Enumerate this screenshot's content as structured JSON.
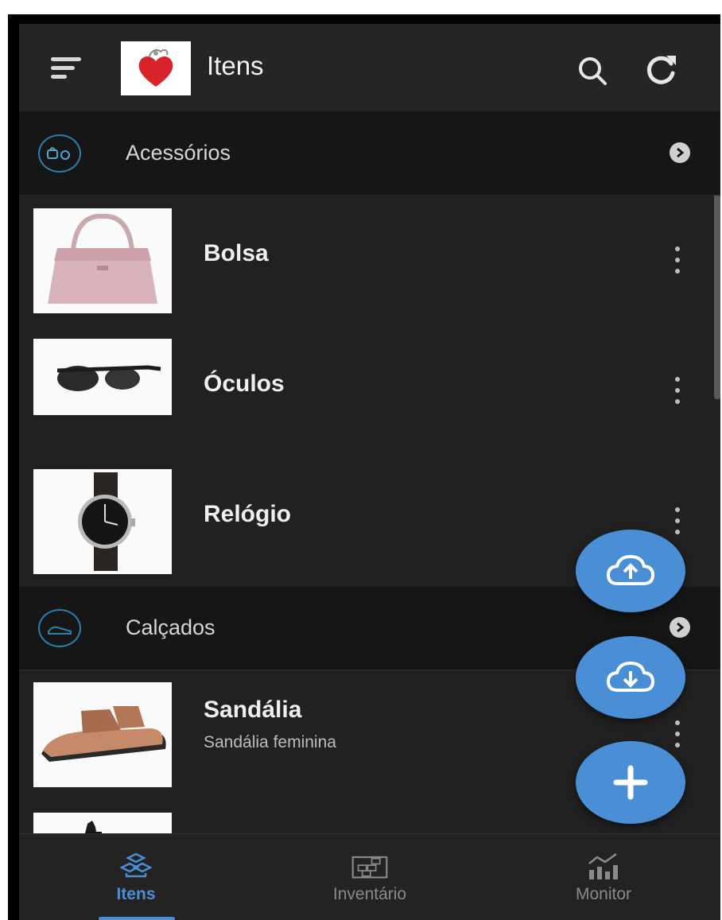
{
  "header": {
    "title": "Itens"
  },
  "categories": [
    {
      "label": "Acessórios",
      "items": [
        {
          "name": "Bolsa",
          "description": ""
        },
        {
          "name": "Óculos",
          "description": ""
        },
        {
          "name": "Relógio",
          "description": ""
        }
      ]
    },
    {
      "label": "Calçados",
      "items": [
        {
          "name": "Sandália",
          "description": "Sandália feminina"
        }
      ]
    }
  ],
  "bottom_nav": [
    {
      "label": "Itens",
      "active": true
    },
    {
      "label": "Inventário",
      "active": false
    },
    {
      "label": "Monitor",
      "active": false
    }
  ],
  "colors": {
    "accent": "#4a8fd6",
    "background": "#212121",
    "category_bg": "#161616"
  },
  "icons": {
    "menu": "menu-icon",
    "search": "search-icon",
    "refresh": "refresh-icon",
    "upload": "cloud-upload-icon",
    "download": "cloud-download-icon",
    "add": "plus-icon"
  }
}
